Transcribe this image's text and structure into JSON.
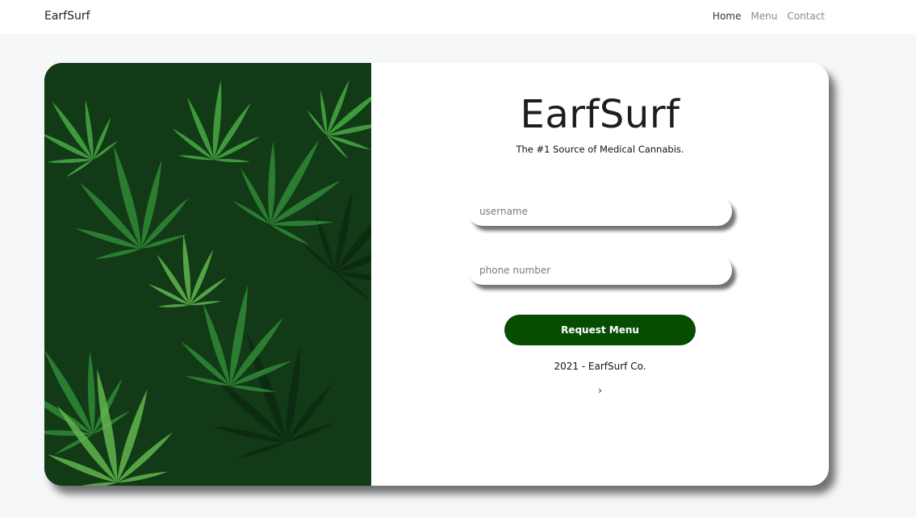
{
  "navbar": {
    "brand": "EarfSurf",
    "links": [
      {
        "label": "Home",
        "active": true
      },
      {
        "label": "Menu",
        "active": false
      },
      {
        "label": "Contact",
        "active": false
      }
    ]
  },
  "hero": {
    "image_subject": "cannabis leaves photo",
    "title": "EarfSurf",
    "subtitle": "The #1 Source of Medical Cannabis.",
    "username_placeholder": "username",
    "phone_placeholder": "phone number",
    "submit_label": "Request Menu",
    "footer": "2021 - EarfSurf Co.",
    "chevron": "›"
  },
  "colors": {
    "button": "#064d02",
    "background": "#f6f7f9",
    "card": "#ffffff"
  }
}
